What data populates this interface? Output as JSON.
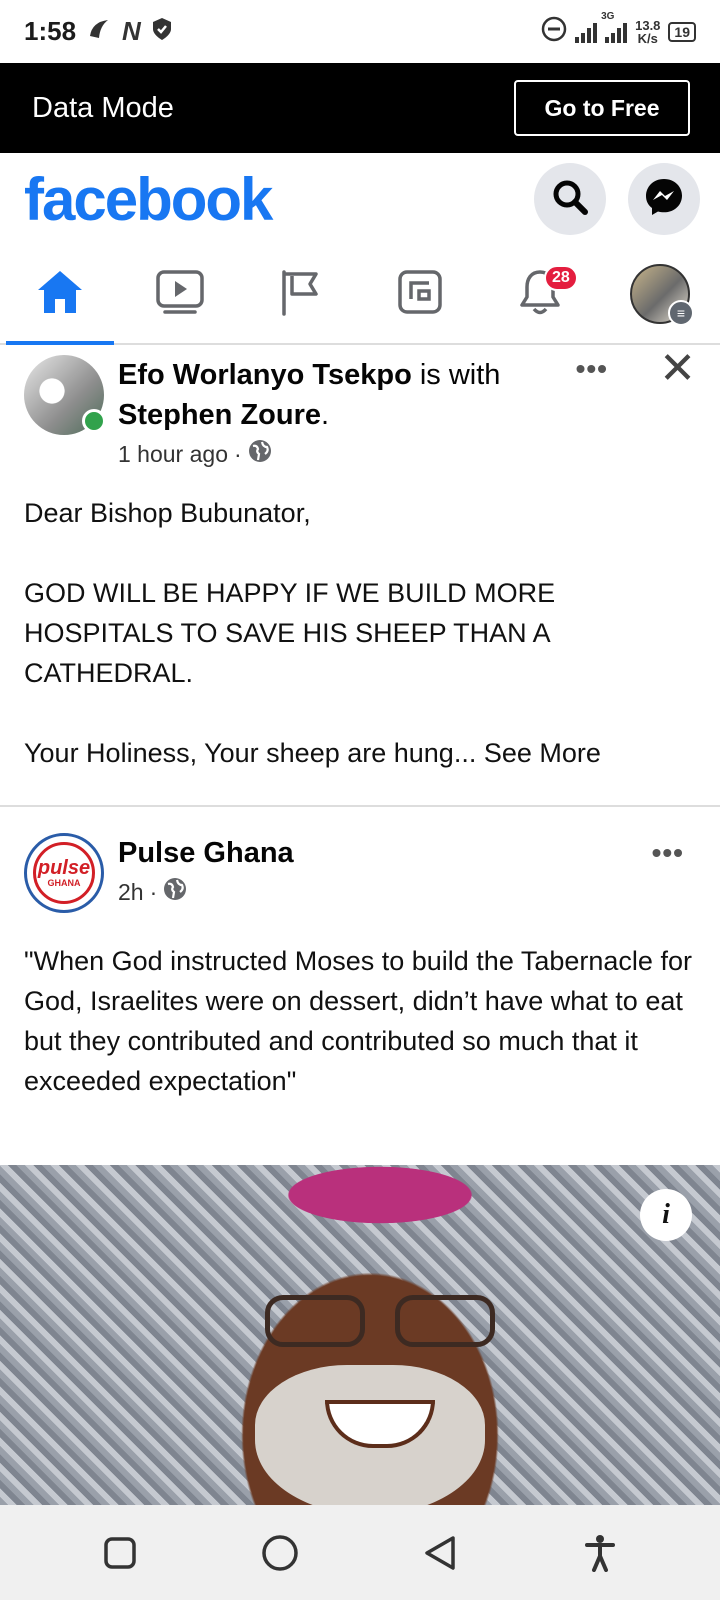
{
  "status_bar": {
    "time": "1:58",
    "speed": "13.8",
    "speed_unit": "K/s",
    "battery": "19",
    "network": "3G"
  },
  "data_mode": {
    "title": "Data Mode",
    "button": "Go to Free"
  },
  "header": {
    "logo": "facebook",
    "icons": [
      "search-icon",
      "messenger-icon"
    ]
  },
  "tabs": [
    {
      "name": "home",
      "icon": "home-icon",
      "active": true
    },
    {
      "name": "watch",
      "icon": "video-icon"
    },
    {
      "name": "pages",
      "icon": "flag-icon"
    },
    {
      "name": "gaming",
      "icon": "gaming-icon"
    },
    {
      "name": "notifications",
      "icon": "bell-icon",
      "badge": "28"
    },
    {
      "name": "menu",
      "icon": "profile-menu-icon"
    }
  ],
  "post1": {
    "author": "Efo Worlanyo Tsekpo",
    "with_text": " is with ",
    "tagged": "Stephen Zoure",
    "period": ".",
    "time": "1 hour ago",
    "privacy": "public",
    "paragraph1": "Dear Bishop Bubunator,",
    "paragraph2": "GOD WILL BE HAPPY IF WE BUILD MORE HOSPITALS TO SAVE HIS SHEEP THAN A CATHEDRAL.",
    "paragraph3": "Your Holiness, Your sheep are hung...",
    "see_more": " See More"
  },
  "post2": {
    "author": "Pulse Ghana",
    "avatar_text_1": "pulse",
    "avatar_text_2": "GHANA",
    "time": "2h",
    "privacy": "public",
    "text": "\"When God instructed Moses to build the Tabernacle for God, Israelites were on dessert, didn’t have what to eat but they contributed and contributed so much that it exceeded expectation\"",
    "info_label": "i"
  },
  "colors": {
    "brand": "#1877f2",
    "badge": "#e41e3f",
    "online": "#31a24c"
  }
}
